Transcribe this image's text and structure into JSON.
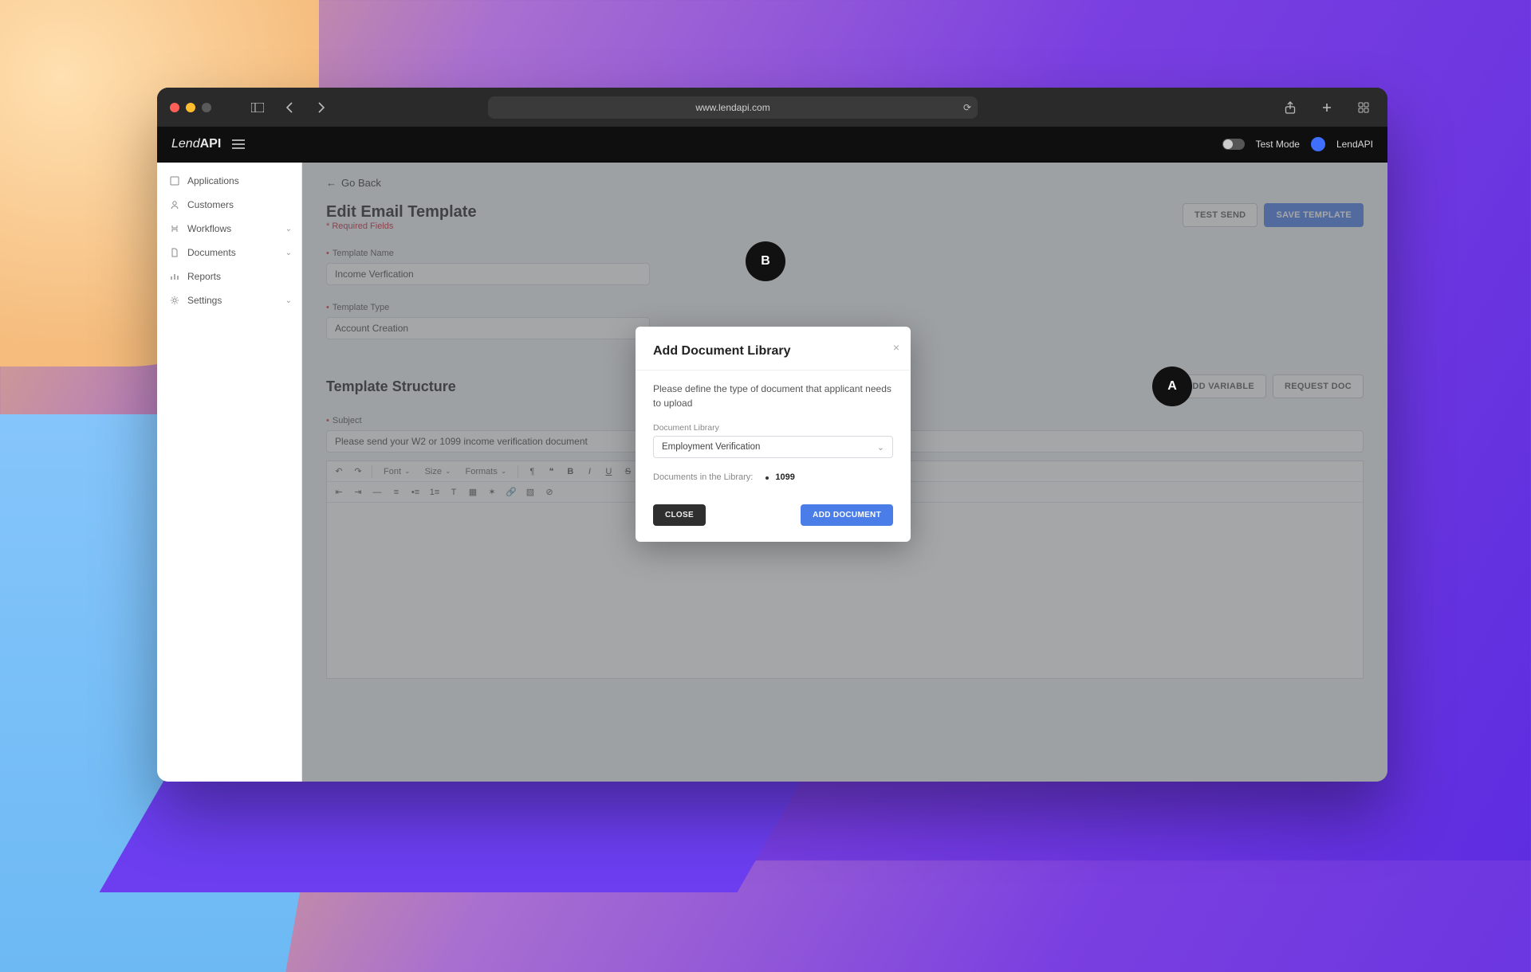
{
  "browser": {
    "url": "www.lendapi.com"
  },
  "header": {
    "brand_prefix": "Lend",
    "brand_bold": "API",
    "test_mode_label": "Test Mode",
    "user_label": "LendAPI"
  },
  "sidebar": {
    "items": [
      {
        "label": "Applications"
      },
      {
        "label": "Customers"
      },
      {
        "label": "Workflows",
        "expandable": true
      },
      {
        "label": "Documents",
        "expandable": true
      },
      {
        "label": "Reports"
      },
      {
        "label": "Settings",
        "expandable": true
      }
    ]
  },
  "page": {
    "go_back": "Go Back",
    "title": "Edit Email Template",
    "required_note": "* Required Fields",
    "test_send": "TEST SEND",
    "save_template": "SAVE TEMPLATE",
    "template_name_label": "Template Name",
    "template_name_value": "Income Verfication",
    "template_type_label": "Template Type",
    "template_type_value": "Account Creation",
    "structure_title": "Template Structure",
    "add_variable": "ADD VARIABLE",
    "request_doc": "REQUEST DOC",
    "subject_label": "Subject",
    "subject_value": "Please send your W2 or 1099 income verification document",
    "editor": {
      "font_label": "Font",
      "size_label": "Size",
      "formats_label": "Formats"
    }
  },
  "modal": {
    "title": "Add Document Library",
    "desc": "Please define the type of document that applicant needs to upload",
    "lib_label": "Document Library",
    "lib_value": "Employment Verification",
    "docs_in_lib_label": "Documents in the Library:",
    "doc_item": "1099",
    "close": "CLOSE",
    "add": "ADD DOCUMENT"
  },
  "callouts": {
    "a": "A",
    "b": "B"
  }
}
